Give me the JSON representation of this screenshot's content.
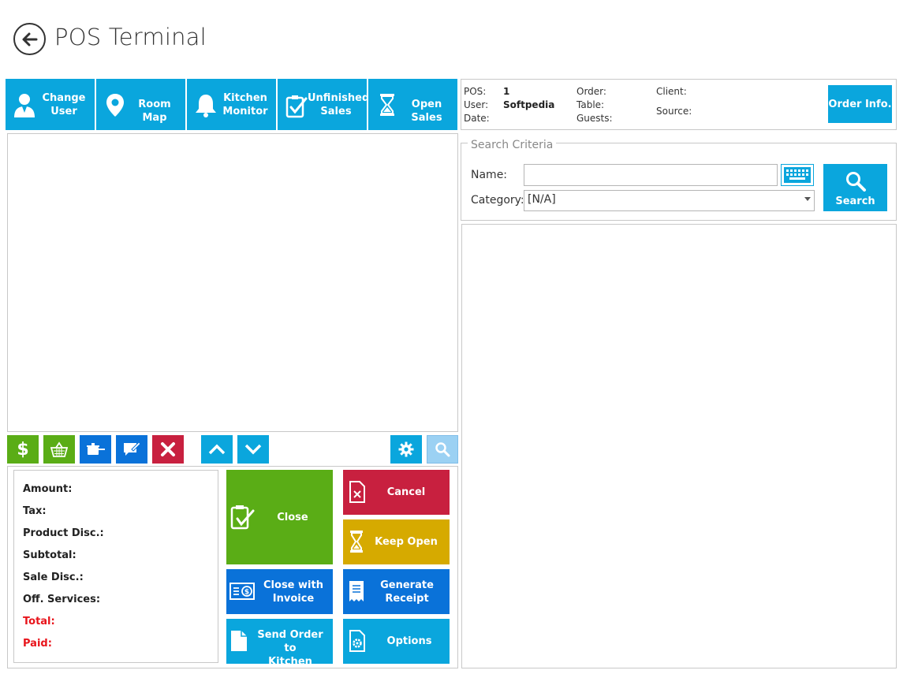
{
  "app": {
    "title": "POS Terminal"
  },
  "toolbar": {
    "change_user": "Change User",
    "change_user_l1": "Change",
    "change_user_l2": "User",
    "room_map": "Room Map",
    "kitchen_monitor_l1": "Kitchen",
    "kitchen_monitor_l2": "Monitor",
    "unfinished_sales_l1": "Unfinished",
    "unfinished_sales_l2": "Sales",
    "open_sales": "Open Sales"
  },
  "info": {
    "pos_label": "POS:",
    "pos_value": "1",
    "user_label": "User:",
    "user_value": "Softpedia",
    "date_label": "Date:",
    "order_label": "Order:",
    "table_label": "Table:",
    "guests_label": "Guests:",
    "client_label": "Client:",
    "source_label": "Source:",
    "order_info_button": "Order Info."
  },
  "search": {
    "legend": "Search Criteria",
    "name_label": "Name:",
    "name_value": "",
    "category_label": "Category:",
    "category_value": "[N/A]",
    "search_button": "Search"
  },
  "totals": {
    "amount": "Amount:",
    "tax": "Tax:",
    "product_disc": "Product Disc.:",
    "subtotal": "Subtotal:",
    "sale_disc": "Sale Disc.:",
    "off_services": "Off. Services:",
    "total": "Total:",
    "paid": "Paid:"
  },
  "actions": {
    "close": "Close",
    "cancel": "Cancel",
    "keep_open": "Keep Open",
    "close_with_invoice_l1": "Close with",
    "close_with_invoice_l2": "Invoice",
    "generate_receipt_l1": "Generate",
    "generate_receipt_l2": "Receipt",
    "send_order_l1": "Send Order to",
    "send_order_l2": "Kitchen",
    "options": "Options"
  },
  "colors": {
    "accent": "#0aa6dd",
    "green": "#5aad16",
    "red": "#c8203f",
    "yellow": "#d6aa00",
    "blue": "#0a72d9",
    "label_red": "#e8141b"
  }
}
